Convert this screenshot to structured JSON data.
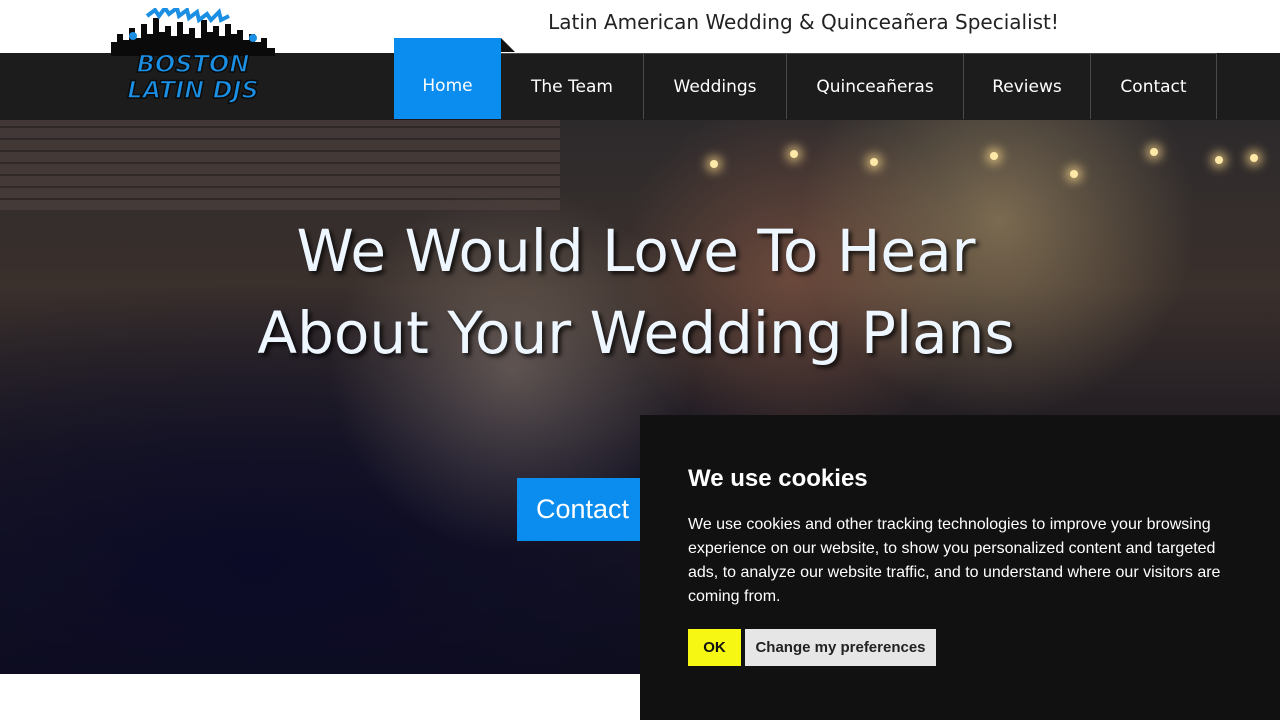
{
  "header": {
    "tagline": "Latin American Wedding & Quinceañera Specialist!",
    "logo": {
      "line1": "BOSTON",
      "line2": "LATIN DJS"
    }
  },
  "nav": {
    "items": [
      {
        "label": "Home",
        "active": true
      },
      {
        "label": "The Team"
      },
      {
        "label": "Weddings"
      },
      {
        "label": "Quinceañeras"
      },
      {
        "label": "Reviews"
      },
      {
        "label": "Contact"
      }
    ]
  },
  "hero": {
    "title_line1": "We Would Love To Hear",
    "title_line2": "About Your Wedding Plans",
    "cta_label": "Contact"
  },
  "cookie": {
    "title": "We use cookies",
    "text": "We use cookies and other tracking technologies to improve your browsing experience on our website, to show you personalized content and targeted ads, to analyze our website traffic, and to understand where our visitors are coming from.",
    "ok_label": "OK",
    "preferences_label": "Change my preferences"
  },
  "colors": {
    "accent": "#0b8df0",
    "nav_bg": "#1c1c1c",
    "cookie_bg": "#111111",
    "ok_button": "#f7f714"
  }
}
